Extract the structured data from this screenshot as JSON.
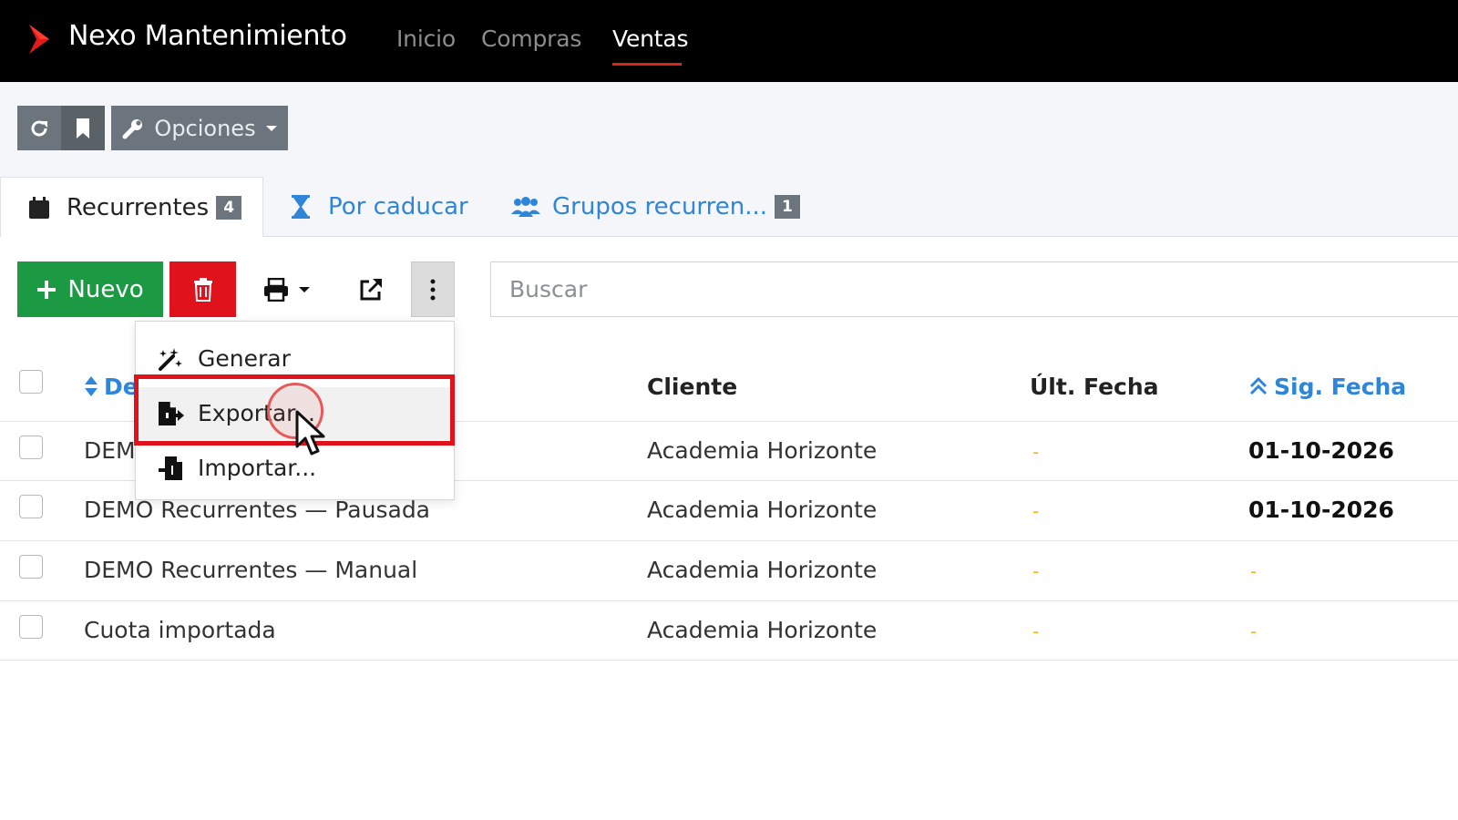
{
  "app": {
    "brand": "Nexo Mantenimiento",
    "nav": [
      {
        "label": "Inicio",
        "active": false
      },
      {
        "label": "Compras",
        "active": false
      },
      {
        "label": "Ventas",
        "active": true
      }
    ]
  },
  "toolbar": {
    "refresh_icon": "refresh-icon",
    "bookmark_icon": "bookmark-icon",
    "options_label": "Opciones"
  },
  "tabs": [
    {
      "label": "Recurrentes",
      "badge": "4",
      "icon": "calendar-icon",
      "active": true
    },
    {
      "label": "Por caducar",
      "badge": "",
      "icon": "hourglass-icon",
      "active": false
    },
    {
      "label": "Grupos recurren...",
      "badge": "1",
      "icon": "users-icon",
      "active": false
    }
  ],
  "actions": {
    "new_label": "Nuevo",
    "search_placeholder": "Buscar"
  },
  "dropdown": {
    "items": [
      {
        "label": "Generar",
        "icon": "magic-wand-icon"
      },
      {
        "label": "Exportar...",
        "icon": "file-export-icon"
      },
      {
        "label": "Importar...",
        "icon": "file-import-icon"
      }
    ]
  },
  "table": {
    "columns": [
      "De",
      "Cliente",
      "Últ. Fecha",
      "Sig. Fecha"
    ],
    "rows": [
      {
        "desc": "DEM",
        "client": "Academia Horizonte",
        "last": "-",
        "next": "01-10-2026"
      },
      {
        "desc": "DEMO Recurrentes — Pausada",
        "client": "Academia Horizonte",
        "last": "-",
        "next": "01-10-2026"
      },
      {
        "desc": "DEMO Recurrentes — Manual",
        "client": "Academia Horizonte",
        "last": "-",
        "next": "-"
      },
      {
        "desc": "Cuota importada",
        "client": "Academia Horizonte",
        "last": "-",
        "next": "-"
      }
    ]
  },
  "colors": {
    "navbar": "#000000",
    "accent_red": "#d9261c",
    "success": "#1c9a43",
    "danger": "#e0121c",
    "link_blue": "#2f86d9",
    "secondary": "#6c757d",
    "dash_yellow": "#f0b429"
  }
}
